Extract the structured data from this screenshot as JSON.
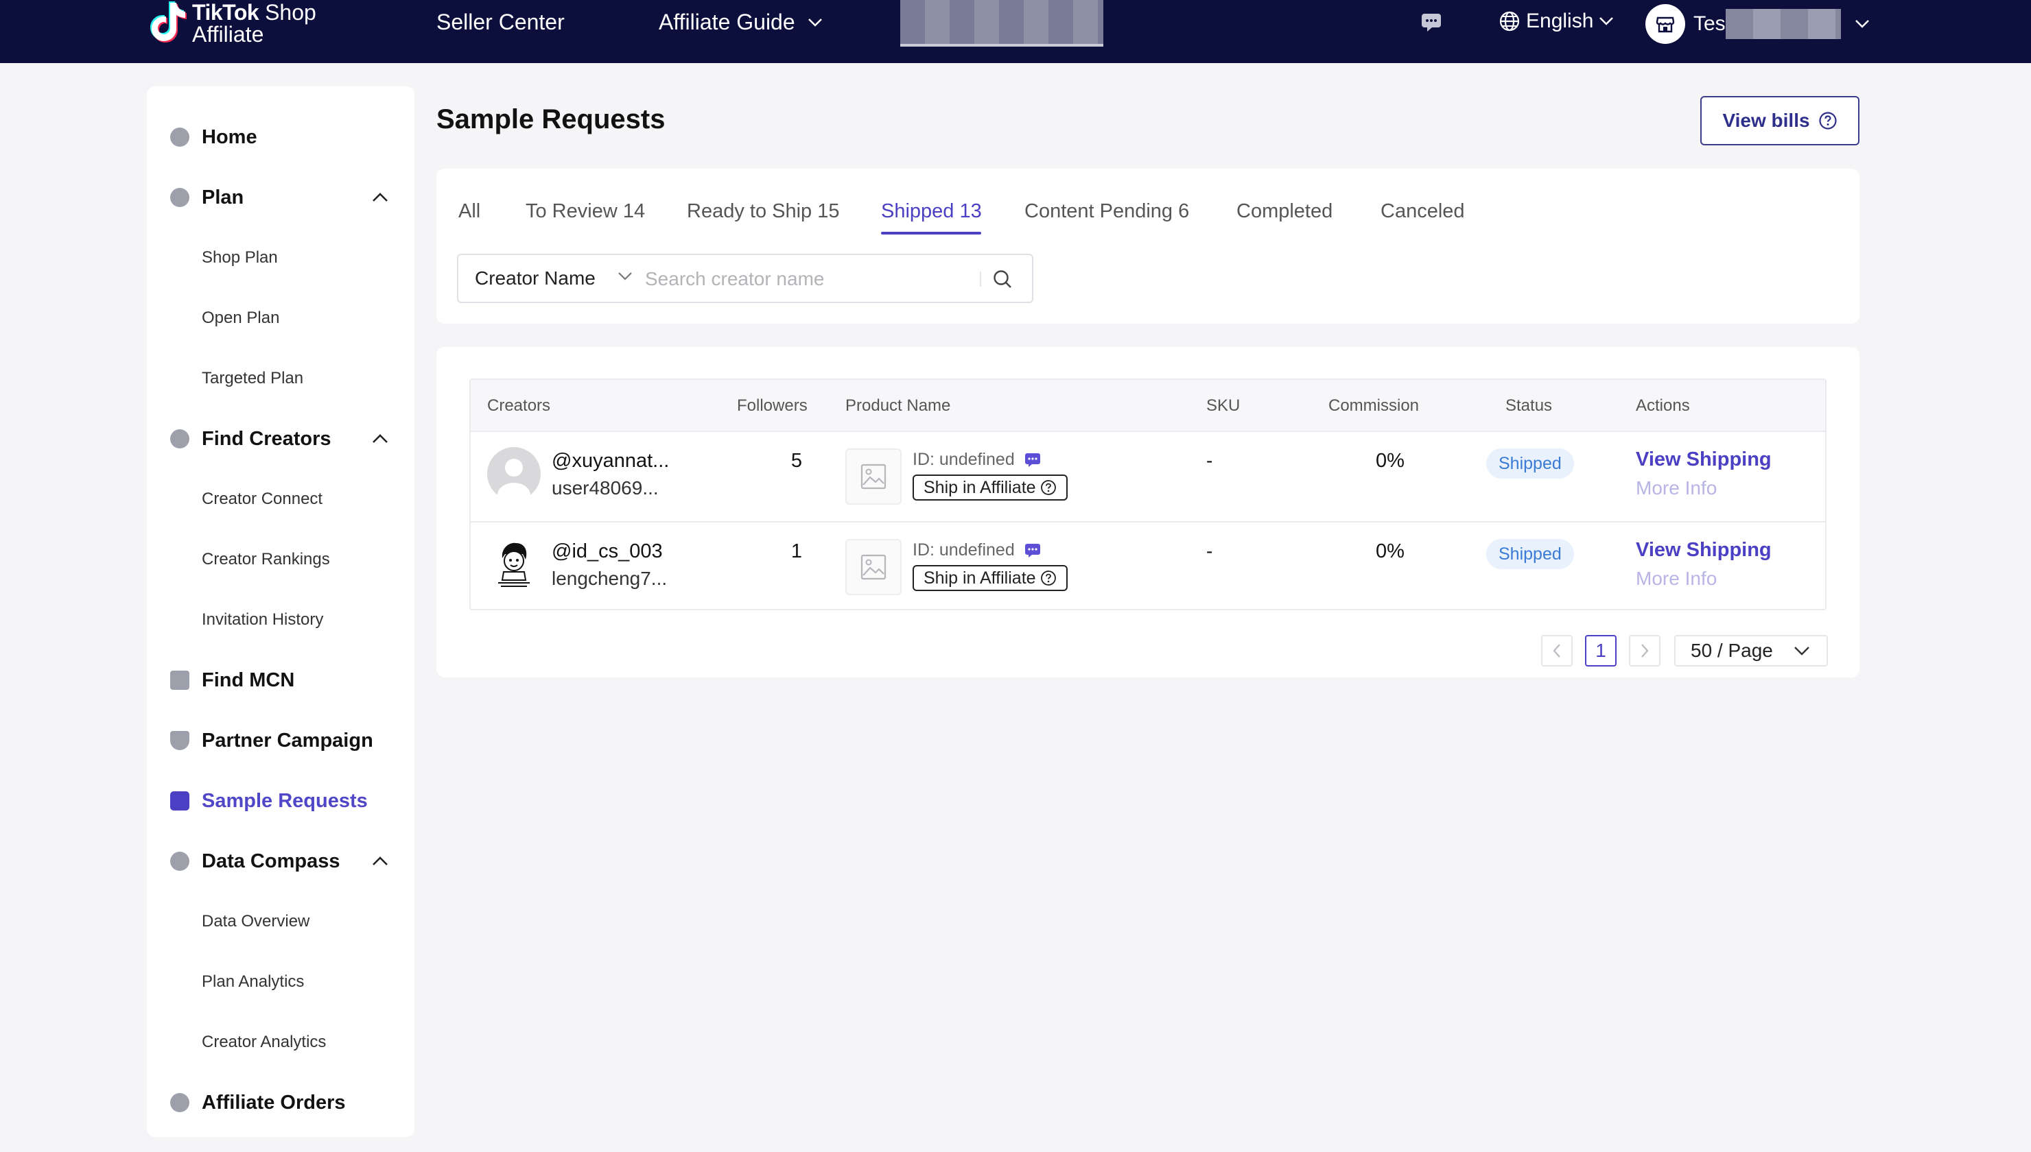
{
  "header": {
    "logo_line1_bold": "TikTok",
    "logo_line1_rest": " Shop",
    "logo_line2": "Affiliate",
    "seller_center": "Seller Center",
    "affiliate_guide": "Affiliate Guide",
    "language": "English",
    "account_name": "Tes"
  },
  "sidebar": {
    "items": [
      {
        "label": "Home",
        "icon": "home-icon"
      },
      {
        "label": "Plan",
        "icon": "plan-icon"
      },
      {
        "label": "Shop Plan"
      },
      {
        "label": "Open Plan"
      },
      {
        "label": "Targeted Plan"
      },
      {
        "label": "Find Creators",
        "icon": "search-creators-icon"
      },
      {
        "label": "Creator Connect"
      },
      {
        "label": "Creator Rankings"
      },
      {
        "label": "Invitation History"
      },
      {
        "label": "Find MCN",
        "icon": "mcn-icon"
      },
      {
        "label": "Partner Campaign",
        "icon": "campaign-icon"
      },
      {
        "label": "Sample Requests",
        "icon": "sample-icon"
      },
      {
        "label": "Data Compass",
        "icon": "compass-icon"
      },
      {
        "label": "Data Overview"
      },
      {
        "label": "Plan Analytics"
      },
      {
        "label": "Creator Analytics"
      },
      {
        "label": "Affiliate Orders",
        "icon": "orders-icon"
      }
    ]
  },
  "main": {
    "title": "Sample Requests",
    "view_bills": "View bills",
    "tabs": [
      {
        "label": "All"
      },
      {
        "label": "To Review 14"
      },
      {
        "label": "Ready to Ship 15"
      },
      {
        "label": "Shipped 13"
      },
      {
        "label": "Content Pending 6"
      },
      {
        "label": "Completed"
      },
      {
        "label": "Canceled"
      }
    ],
    "search": {
      "field": "Creator Name",
      "placeholder": "Search creator name"
    },
    "table": {
      "headers": [
        "Creators",
        "Followers",
        "Product Name",
        "SKU",
        "Commission",
        "Status",
        "Actions"
      ],
      "rows": [
        {
          "handle": "@xuyannat...",
          "user": "user48069...",
          "followers": "5",
          "product_id": "ID: undefined",
          "ship_tag": "Ship in Affiliate",
          "sku": "-",
          "commission": "0%",
          "status": "Shipped",
          "action_primary": "View Shipping",
          "action_secondary": "More Info"
        },
        {
          "handle": "@id_cs_003",
          "user": "lengcheng7...",
          "followers": "1",
          "product_id": "ID: undefined",
          "ship_tag": "Ship in Affiliate",
          "sku": "-",
          "commission": "0%",
          "status": "Shipped",
          "action_primary": "View Shipping",
          "action_secondary": "More Info"
        }
      ]
    },
    "pagination": {
      "current_page": "1",
      "page_size": "50 / Page"
    }
  },
  "colors": {
    "topbar": "#0c0f3b",
    "accent": "#4b40c4",
    "status_bg": "#e8f1fc",
    "status_text": "#3a7bd5"
  }
}
